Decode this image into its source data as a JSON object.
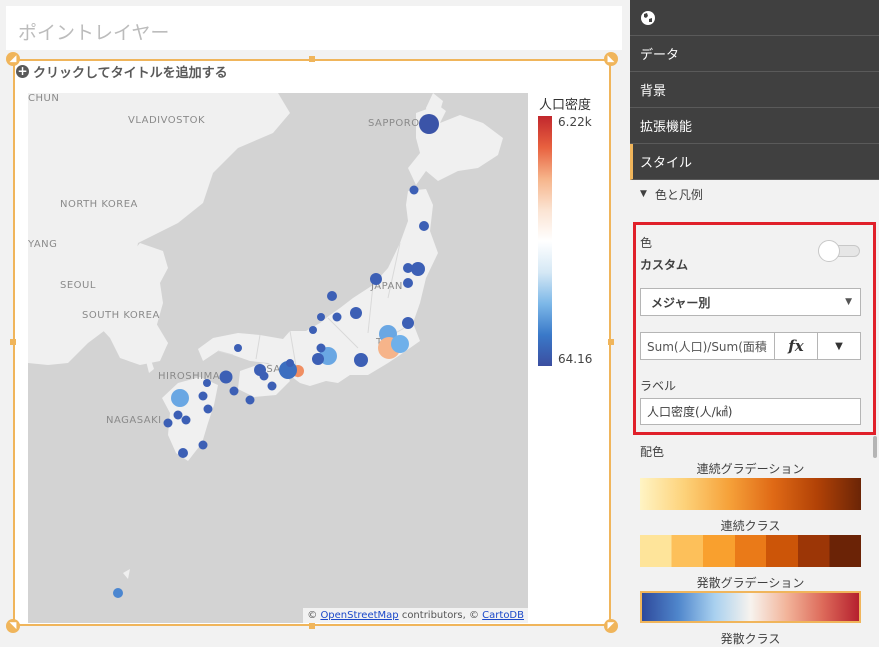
{
  "viz": {
    "title": "ポイントレイヤー",
    "add_title": "クリックしてタイトルを追加する"
  },
  "map": {
    "labels": {
      "chun": "CHUN",
      "vladivostok": "VLADIVOSTOK",
      "sapporo": "SAPPORO",
      "north_korea": "NORTH KOREA",
      "pyongyang": "YANG",
      "seoul": "SEOUL",
      "south_korea": "SOUTH KOREA",
      "hiroshima": "HIROSHIMA",
      "nagasaki": "NAGASAKI",
      "osaka": "OSAKA",
      "tokyo": "TOKY",
      "japan": "JAPAN"
    },
    "attribution": {
      "prefix": "© ",
      "osm": "OpenStreetMap",
      "middle": " contributors, © ",
      "carto": "CartoDB"
    }
  },
  "legend": {
    "title": "人口密度",
    "max": "6.22k",
    "min": "64.16"
  },
  "panel": {
    "globe_icon": "globe-icon",
    "sections": [
      "データ",
      "背景",
      "拡張機能",
      "スタイル"
    ],
    "subsection": "色と凡例",
    "color_label": "色",
    "custom_label": "カスタム",
    "color_mode": "メジャー別",
    "expression": "Sum(人口)/Sum(面積",
    "fx": "fx",
    "label_title": "ラベル",
    "label_value": "人口密度(人/㎢)",
    "scheme_title": "配色",
    "schemes": [
      "連続グラデーション",
      "連続クラス",
      "発散グラデーション",
      "発散クラス"
    ]
  },
  "colors": {
    "accent": "#f0b55b",
    "highlight": "#e0202a",
    "panel_dark": "#404040"
  }
}
